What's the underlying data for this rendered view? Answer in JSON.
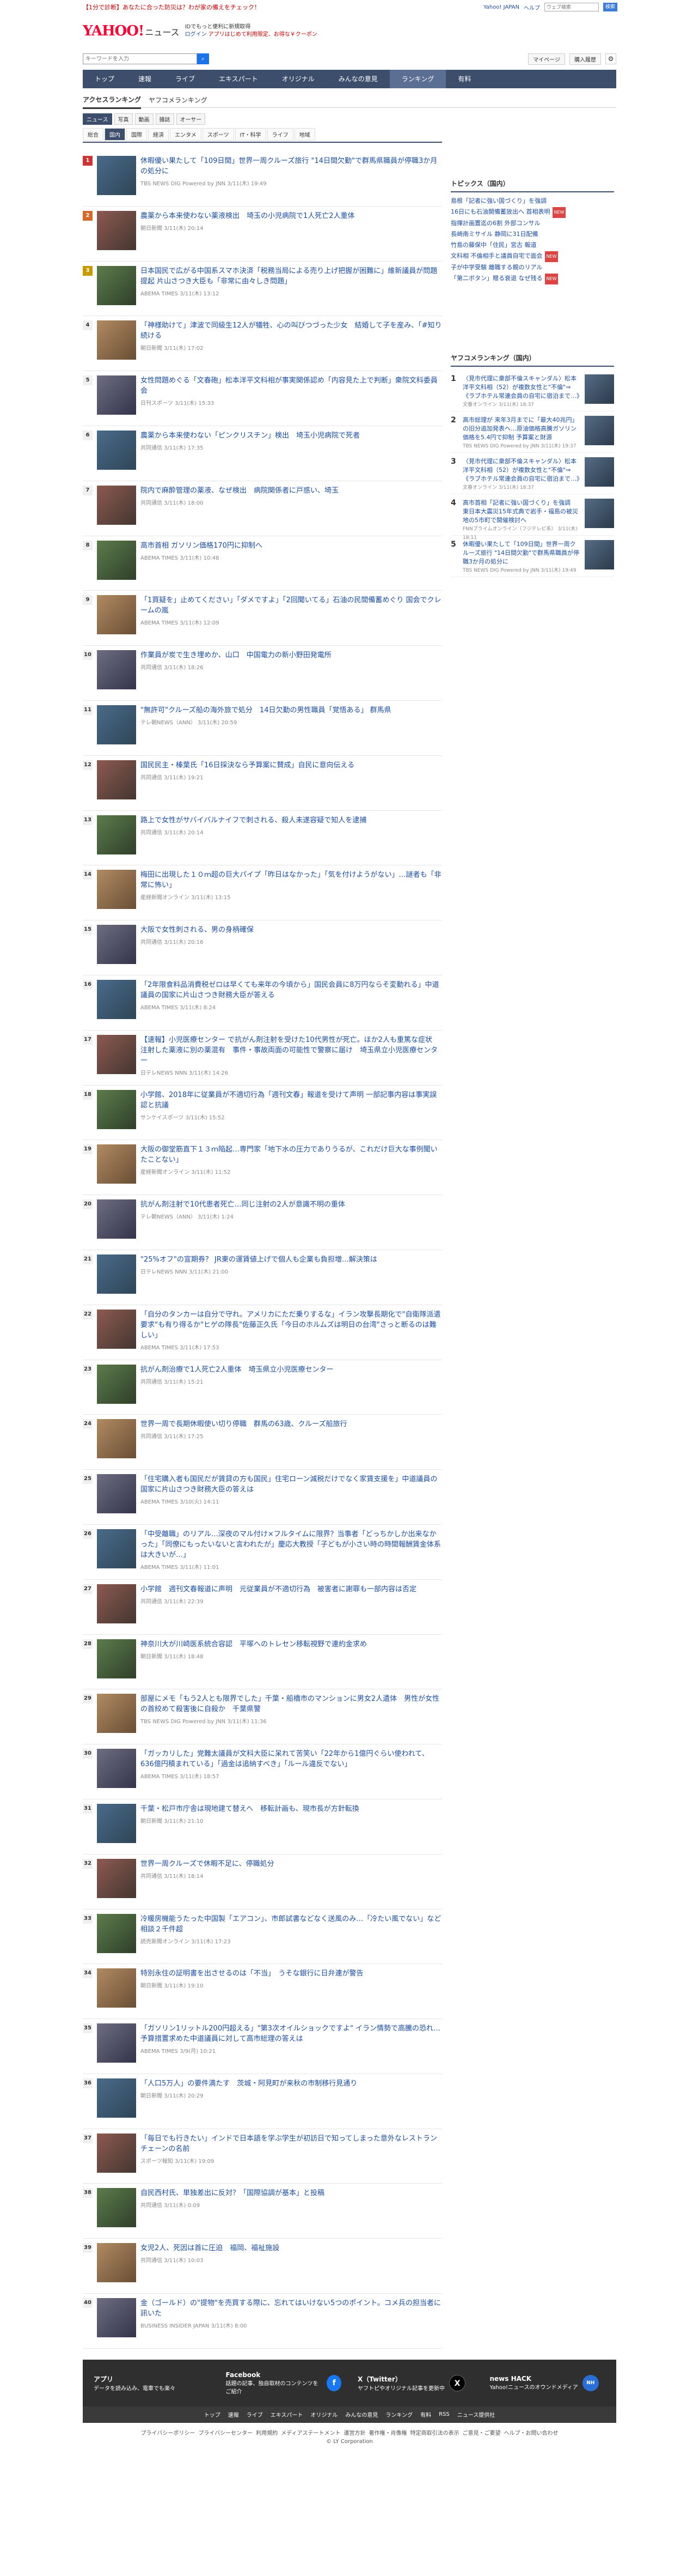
{
  "topbar": {
    "promo": "【1分で診断】あなたに合った防災は？わが家の備えをチェック！",
    "links": [
      "Yahoo! JAPAN",
      "ヘルプ"
    ],
    "search_placeholder": "ウェブ検索",
    "search_button": "検索"
  },
  "masthead": {
    "logo_main": "YAHOO!",
    "logo_sub": "JAPAN",
    "logo_service": "ニュース",
    "info_line": "IDでもっと便利に新規取得",
    "login": "ログイン",
    "hint": "アプリはじめて利用限定、お得な￥クーポン"
  },
  "search": {
    "placeholder": "キーワードを入力",
    "mypage": "マイページ",
    "subscribe": "購入履歴"
  },
  "gnav": [
    "トップ",
    "速報",
    "ライブ",
    "エキスパート",
    "オリジナル",
    "みんなの意見",
    "ランキング",
    "有料"
  ],
  "gnav_current": "ランキング",
  "subtabs": [
    "アクセスランキング",
    "ヤフコメランキング"
  ],
  "mediatabs": [
    "ニュース",
    "写真",
    "動画",
    "雑誌",
    "オーサー"
  ],
  "cattabs": [
    "総合",
    "国内",
    "国際",
    "経済",
    "エンタメ",
    "スポーツ",
    "IT・科学",
    "ライフ",
    "地域"
  ],
  "ranking": [
    {
      "no": "1",
      "title": "休暇優い果たして「109日間」世界一周クルーズ旅行 \"14日間欠勤\"で群馬県職員が停職3か月の処分に",
      "meta": "TBS NEWS DIG Powered by JNN  3/11(木) 19:49"
    },
    {
      "no": "2",
      "title": "農薬から本来使わない薬液検出　埼玉の小児病院で1人死亡2人重体",
      "meta": "朝日新聞  3/11(木) 20:14"
    },
    {
      "no": "3",
      "title": "日本国民で広がる中国系スマホ決済「税務当局による売り上げ把握が困難に」維新議員が問題提起 片山さつき大臣も「非常に由々しき問題」",
      "meta": "ABEMA TIMES  3/11(木) 13:12"
    },
    {
      "no": "4",
      "title": "「神様助けて」津波で同級生12人が犠牲、心の叫びつづった少女　結婚して子を産み、「#知り続ける",
      "meta": "朝日新聞  3/11(木) 17:02"
    },
    {
      "no": "5",
      "title": "女性問題めぐる「文春砲」松本洋平文科相が事実関係認め「内容見た上で判断」衆院文科委員会",
      "meta": "日刊スポーツ  3/11(木) 15:33"
    },
    {
      "no": "6",
      "title": "農薬から本来使わない「ピンクリスチン」検出　埼玉小児病院で死者",
      "meta": "共同通信  3/11(木) 17:35"
    },
    {
      "no": "7",
      "title": "院内で麻酔管理の薬液、なぜ検出　病院関係者に戸惑い、埼玉",
      "meta": "共同通信  3/11(木) 18:00"
    },
    {
      "no": "8",
      "title": "高市首相 ガソリン価格170円に抑制へ",
      "meta": "ABEMA TIMES  3/11(木) 10:48"
    },
    {
      "no": "9",
      "title": "「1買疑を」止めてください」「ダメですよ」「2回聞いてる」石油の民間備蓄めぐり 国会でクレームの嵐",
      "meta": "ABEMA TIMES  3/11(木) 12:09"
    },
    {
      "no": "10",
      "title": "作業員が炭で生き埋めか、山口　中国電力の新小野田発電所",
      "meta": "共同通信  3/11(木) 18:26"
    },
    {
      "no": "11",
      "title": "\"無許可\"クルーズ船の海外旅で処分　14日欠勤の男性職員「覚悟ある」 群馬県",
      "meta": "テレ朝NEWS（ANN）  3/11(木) 20:59"
    },
    {
      "no": "12",
      "title": "国民民主・榛葉氏「16日採決なら予算案に賛成」自民に意向伝える",
      "meta": "共同通信  3/11(木) 19:21"
    },
    {
      "no": "13",
      "title": "路上で女性がサバイバルナイフで刺される、殺人未遂容疑で知人を逮捕",
      "meta": "共同通信  3/11(木) 20:14"
    },
    {
      "no": "14",
      "title": "梅田に出現した１０ｍ超の巨大パイプ「昨日はなかった」「気を付けようがない」…謎者も「非常に怖い」",
      "meta": "産経新聞オンライン  3/11(木) 13:15"
    },
    {
      "no": "15",
      "title": "大阪で女性刺される、男の身柄確保",
      "meta": "共同通信  3/11(木) 20:16"
    },
    {
      "no": "16",
      "title": "「2年限食料品消費税ゼロは早くても来年の今頃から」国民会員に8万円ならそ変動れる」中道議員の国家に片山さつき財務大臣が答える",
      "meta": "ABEMA TIMES  3/11(木) 8:24"
    },
    {
      "no": "17",
      "title": "【速報】小児医療センター で抗がん剤注射を受けた10代男性が死亡。ほか2人も重篤な症状　注射した薬液に別の薬混有　事件・事故両面の可能性で警察に届け　埼玉県立小児医療センター",
      "meta": "日テレNEWS NNN  3/11(木) 14:26"
    },
    {
      "no": "18",
      "title": "小学館、2018年に従業員が不適切行為「週刊文春」報道を受けて声明 一部記事内容は事実誤認と抗議",
      "meta": "サンケイスポーツ  3/11(木) 15:52"
    },
    {
      "no": "19",
      "title": "大阪の御堂筋直下１３ｍ陥起…専門家「地下水の圧力でありうるが、これだけ巨大な事例聞いたことない」",
      "meta": "産経新聞オンライン  3/11(木) 11:52"
    },
    {
      "no": "20",
      "title": "抗がん剤注射で10代患者死亡…同じ注射の2人が意識不明の重体",
      "meta": "テレ朝NEWS（ANN）  3/11(木) 1:24"
    },
    {
      "no": "21",
      "title": "\"25%オフ\"の宣期券？ JR東の運賃値上げで個人も企業も負担増…解決策は",
      "meta": "日テレNEWS NNN  3/11(木) 21:00"
    },
    {
      "no": "22",
      "title": "「自分のタンカーは自分で守れ。アメリカにただ乗りするな」イラン攻撃長期化で\"自衛隊派遣要求\"も有り得るか\"ヒゲの隊長\"佐藤正久氏「今日のホルムズは明日の台湾\"さっと断るのは難しい」",
      "meta": "ABEMA TIMES  3/11(木) 17:53"
    },
    {
      "no": "23",
      "title": "抗がん剤治療で1人死亡2人重体　埼玉県立小児医療センター",
      "meta": "共同通信  3/11(木) 15:21"
    },
    {
      "no": "24",
      "title": "世界一周で長期休暇使い切り停職　群馬の63歳、クルーズ船旅行",
      "meta": "共同通信  3/11(木) 17:25"
    },
    {
      "no": "25",
      "title": "「住宅購入者も国民だが賃貸の方も国民」住宅ローン減税だけでなく家賃支援を」中道議員の国家に片山さつき財務大臣の答えは",
      "meta": "ABEMA TIMES  3/10(火) 14:11"
    },
    {
      "no": "26",
      "title": "「中受離職」のリアル…深夜のマル付け×フルタイムに限界？当事者「どっちかしか出来なかった」「同僚にもったいないと言われたが」慶応大教授「子どもが小さい時の時間報酬賃金体系は大きいが…」",
      "meta": "ABEMA TIMES  3/11(木) 11:01"
    },
    {
      "no": "27",
      "title": "小学館　週刊文春報道に声明　元従業員が不適切行為　被害者に謝罪も一部内容は否定",
      "meta": "共同通信  3/11(木) 22:39"
    },
    {
      "no": "28",
      "title": "神奈川大が川崎医系統合容認　平塚へのトレセン移転視野で連約金求め",
      "meta": "朝日新聞  3/11(木) 18:48"
    },
    {
      "no": "29",
      "title": "部屋にメモ「もう2人とも限界でした」千葉・船橋市のマンションに男女2人遺体　男性が女性の首絞めて殺害後に自殺か　千葉県警",
      "meta": "TBS NEWS DIG Powered by JNN  3/11(木) 11:36"
    },
    {
      "no": "30",
      "title": "「ガッカリした」党難太議員が文科大臣に呆れて苦笑い「22年から1億円ぐらい使われて、636億円積まれている」「過金は追納すべき」「ルール違反でない」",
      "meta": "ABEMA TIMES  3/11(木) 18:57"
    },
    {
      "no": "31",
      "title": "千葉・松戸市庁舎は現地建て替えへ　移転計画も、現市長が方針転換",
      "meta": "朝日新聞  3/11(木) 21:10"
    },
    {
      "no": "32",
      "title": "世界一周クルーズで休暇不足に、停職処分",
      "meta": "共同通信  3/11(木) 18:14"
    },
    {
      "no": "33",
      "title": "冷暖房機能うたった中国製「エアコン」、市郎試書などなく送風のみ…「冷たい風でない」など相談２千件超",
      "meta": "読売新聞オンライン  3/11(木) 17:23"
    },
    {
      "no": "34",
      "title": "特別永住の証明書を出させるのは「不当」　うそな銀行に日弁連が警告",
      "meta": "朝日新聞  3/11(木) 19:10"
    },
    {
      "no": "35",
      "title": "「ガソリン1リットル200円超える」\"第3次オイルショックですよ\" イラン情勢で高騰の恐れ…予算措置求めた中道議員に対して高市総理の答えは",
      "meta": "ABEMA TIMES  3/9(月) 10:21"
    },
    {
      "no": "36",
      "title": "「人口5万人」の要件満たす　茨城・阿見町が来秋の市制移行見通り",
      "meta": "朝日新聞  3/11(木) 20:29"
    },
    {
      "no": "37",
      "title": "「毎日でも行きたい」インドで日本語を学ぶ学生が初訪日で知ってしまった意外なレストランチェーンの名前",
      "meta": "スポーツ報知  3/11(木) 19:09"
    },
    {
      "no": "38",
      "title": "自民西村氏、単独差出に反対？「国際協調が基本」と投稿",
      "meta": "共同通信  3/11(木) 0:09"
    },
    {
      "no": "39",
      "title": "女児2人、死因は首に圧迫　福岡、福祉施設",
      "meta": "共同通信  3/11(木) 10:03"
    },
    {
      "no": "40",
      "title": "金（ゴールド）の\"提物\"を売買する際に、忘れてはいけない5つのポイント。コメ兵の担当者に訊いた",
      "meta": "BUSINESS INSIDER JAPAN  3/11(木) 8:00"
    }
  ],
  "topics": {
    "title": "トピックス（国内）",
    "items": [
      {
        "label": "島根「記者に強い国づくり」を強調",
        "badge": ""
      },
      {
        "label": "16日にも石油開備蓄放出へ 首相表明",
        "badge": "NEW"
      },
      {
        "label": "指揮計画置迄の6割 外部コンサル",
        "badge": ""
      },
      {
        "label": "長崎南ミサイル 静岡に31日配備",
        "badge": ""
      },
      {
        "label": "竹島の藤保中「住民」宮古 報道",
        "badge": ""
      },
      {
        "label": "文科相 不倫相手と議員自宅で面会",
        "badge": "NEW"
      },
      {
        "label": "子が中学受験 離職する親のリアル",
        "badge": ""
      },
      {
        "label": "「第二ボタン」贈る衰退 なぜ残る",
        "badge": "NEW"
      }
    ]
  },
  "comment_ranking": {
    "title": "ヤフコメランキング（国内）",
    "items": [
      {
        "no": "1",
        "title": "〈見市代理に衆部不倫スキャンダル〉松本洋平文科相（52）が複数女性と\"不倫\"⇒《ラブホテル常連会員の自宅に宿泊まで…》",
        "meta": "文春オンライン  3/11(木) 18:37"
      },
      {
        "no": "2",
        "title": "高市総理が 来年3月までに「最大40兆円」の旧分追加発表へ…原油価格高騰ガソリン価格を5.4円で抑制 予算案と財源",
        "meta": "TBS NEWS DIG Powered by JNN  3/11(木) 19:37"
      },
      {
        "no": "3",
        "title": "〈見市代理に衆部不倫スキャンダル〉松本洋平文科相（52）が複数女性と\"不倫\"⇒《ラブホテル常連会員の自宅に宿泊まで…》",
        "meta": "文春オンライン  3/11(木) 18:37"
      },
      {
        "no": "4",
        "title": "高市首相「記者に強い国づくり」を強調　東日本大震災15年式典で岩手・福島の被災地の5市町で開催検討へ",
        "meta": "FNNプライムオンライン（フジテレビ系）  3/11(木) 18:11"
      },
      {
        "no": "5",
        "title": "休暇優い果たして「109日間」世界一周クルーズ旅行 \"14日間欠勤\"で群馬県職員が停職3か月の処分に",
        "meta": "TBS NEWS DIG Powered by JNN  3/11(木) 19:49"
      }
    ]
  },
  "footer": {
    "app_title": "アプリ",
    "app_desc": "データを読み込み、電車でも楽々",
    "fb_title": "Facebook",
    "fb_desc": "話題の記事、独自取材のコンテンツをご紹介",
    "x_title": "X（Twitter）",
    "x_desc": "ヤフトピやオリジナル記事を更新中",
    "hack_title": "news HACK",
    "hack_desc": "Yahoo!ニュースのオウンドメディア",
    "nav": [
      "トップ",
      "速報",
      "ライブ",
      "エキスパート",
      "オリジナル",
      "みんなの意見",
      "ランキング",
      "有料",
      "RSS",
      "ニュース提供社"
    ],
    "links": [
      "プライバシーポリシー",
      "プライバシーセンター",
      "利用規約",
      "メディアステートメント",
      "運営方針",
      "著作権・肖像権",
      "特定商取引法の表示",
      "ご意見・ご要望",
      "ヘルプ・お問い合わせ"
    ],
    "copyright": "© LY Corporation"
  }
}
